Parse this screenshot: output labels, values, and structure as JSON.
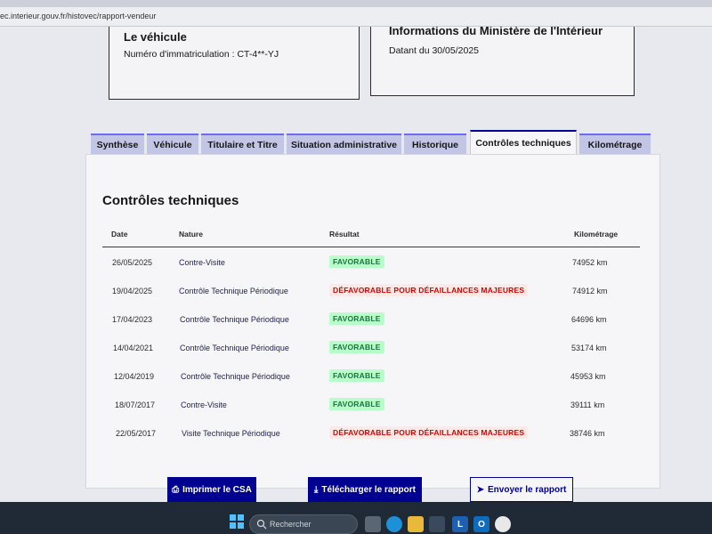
{
  "browser": {
    "url": "ec.interieur.gouv.fr/histovec/rapport-vendeur"
  },
  "vehicle_card": {
    "title": "Le véhicule",
    "plate_label": "Numéro d'immatriculation : CT-4**-YJ"
  },
  "ministry_card": {
    "title": "Informations du Ministère de l'Intérieur",
    "date_label": "Datant du 30/05/2025"
  },
  "tabs": [
    {
      "label": "Synthèse",
      "active": false
    },
    {
      "label": "Véhicule",
      "active": false
    },
    {
      "label": "Titulaire et Titre",
      "active": false
    },
    {
      "label": "Situation administrative",
      "active": false
    },
    {
      "label": "Historique",
      "active": false
    },
    {
      "label": "Contrôles techniques",
      "active": true
    },
    {
      "label": "Kilométrage",
      "active": false
    }
  ],
  "controls": {
    "title": "Contrôles techniques",
    "columns": {
      "date": "Date",
      "nature": "Nature",
      "result": "Résultat",
      "mileage": "Kilométrage"
    },
    "rows": [
      {
        "date": "26/05/2025",
        "nature": "Contre-Visite",
        "result": "FAVORABLE",
        "status": "ok",
        "mileage": "74952 km"
      },
      {
        "date": "19/04/2025",
        "nature": "Contrôle Technique Périodique",
        "result": "DÉFAVORABLE POUR DÉFAILLANCES MAJEURES",
        "status": "ko",
        "mileage": "74912 km"
      },
      {
        "date": "17/04/2023",
        "nature": "Contrôle Technique Périodique",
        "result": "FAVORABLE",
        "status": "ok",
        "mileage": "64696 km"
      },
      {
        "date": "14/04/2021",
        "nature": "Contrôle Technique Périodique",
        "result": "FAVORABLE",
        "status": "ok",
        "mileage": "53174 km"
      },
      {
        "date": "12/04/2019",
        "nature": "Contrôle Technique Périodique",
        "result": "FAVORABLE",
        "status": "ok",
        "mileage": "45953 km"
      },
      {
        "date": "18/07/2017",
        "nature": "Contre-Visite",
        "result": "FAVORABLE",
        "status": "ok",
        "mileage": "39111 km"
      },
      {
        "date": "22/05/2017",
        "nature": "Visite Technique Périodique",
        "result": "DÉFAVORABLE POUR DÉFAILLANCES MAJEURES",
        "status": "ko",
        "mileage": "38746 km"
      }
    ]
  },
  "actions": {
    "print_label": "Imprimer le CSA",
    "download_label": "Télécharger le rapport",
    "send_label": "Envoyer le rapport"
  },
  "taskbar": {
    "search_placeholder": "Rechercher"
  },
  "colors": {
    "brand_blue": "#000091",
    "favorable_bg": "#b8fec9",
    "favorable_text": "#18753c",
    "defavorable_text": "#ce0500"
  }
}
